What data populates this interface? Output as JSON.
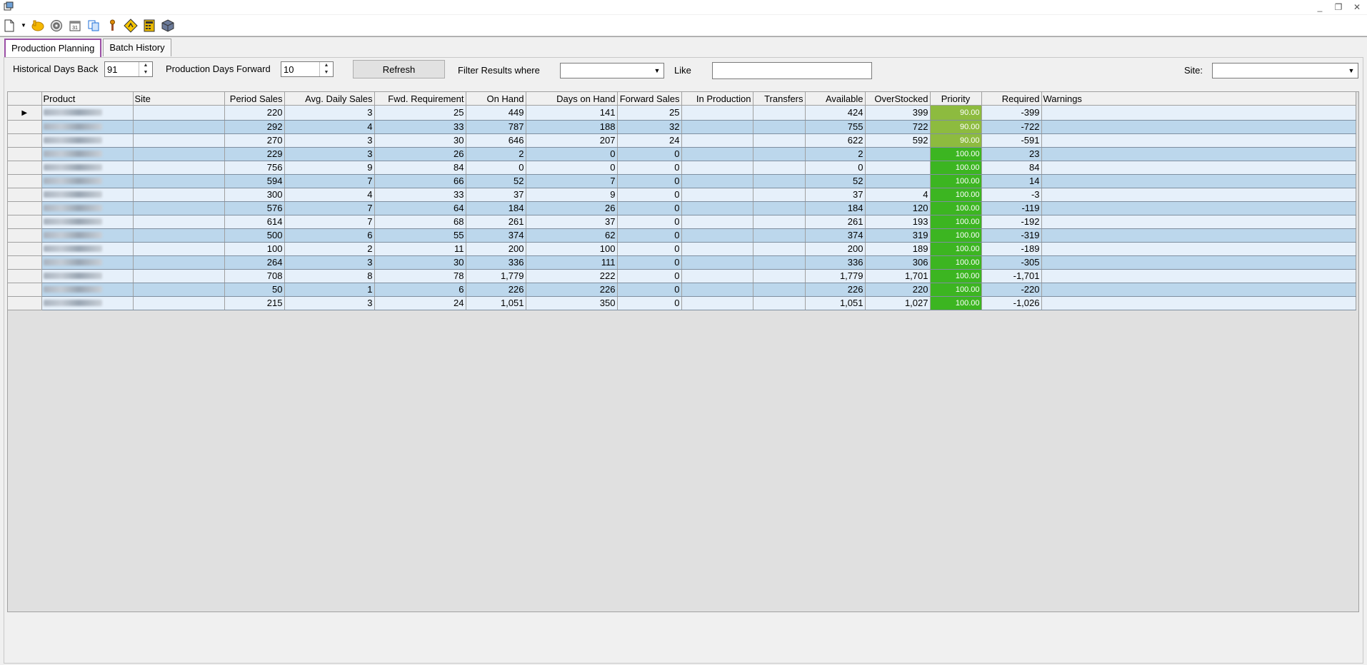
{
  "window": {
    "controls": [
      "_",
      "❐",
      "✕"
    ]
  },
  "toolbar": {
    "icons": [
      "new-document-icon",
      "dropdown-arrow-icon",
      "hand-icon",
      "disc-icon",
      "calendar-icon",
      "copy-icon",
      "tools-icon",
      "sign-icon",
      "calculator-icon",
      "cube-icon"
    ]
  },
  "tabs": [
    {
      "label": "Production Planning",
      "active": true
    },
    {
      "label": "Batch History",
      "active": false
    }
  ],
  "filters": {
    "historical_label": "Historical Days Back",
    "historical_value": "91",
    "forward_label": "Production Days Forward",
    "forward_value": "10",
    "refresh_label": "Refresh",
    "filter_label": "Filter Results where",
    "filter_value": "",
    "like_label": "Like",
    "like_value": "",
    "site_label": "Site:",
    "site_value": ""
  },
  "grid": {
    "columns": [
      "Product",
      "Site",
      "Period Sales",
      "Avg. Daily Sales",
      "Fwd. Requirement",
      "On Hand",
      "Days on Hand",
      "Forward Sales",
      "In Production",
      "Transfers",
      "Available",
      "OverStocked",
      "Priority",
      "Required",
      "Warnings"
    ],
    "rows": [
      {
        "period": "220",
        "avg": "3",
        "fwd": "25",
        "onhand": "449",
        "days": "141",
        "fsales": "25",
        "avail": "424",
        "over": "399",
        "prio": "90.00",
        "req": "-399"
      },
      {
        "period": "292",
        "avg": "4",
        "fwd": "33",
        "onhand": "787",
        "days": "188",
        "fsales": "32",
        "avail": "755",
        "over": "722",
        "prio": "90.00",
        "req": "-722"
      },
      {
        "period": "270",
        "avg": "3",
        "fwd": "30",
        "onhand": "646",
        "days": "207",
        "fsales": "24",
        "avail": "622",
        "over": "592",
        "prio": "90.00",
        "req": "-591"
      },
      {
        "period": "229",
        "avg": "3",
        "fwd": "26",
        "onhand": "2",
        "days": "0",
        "fsales": "0",
        "avail": "2",
        "over": "",
        "prio": "100.00",
        "req": "23"
      },
      {
        "period": "756",
        "avg": "9",
        "fwd": "84",
        "onhand": "0",
        "days": "0",
        "fsales": "0",
        "avail": "0",
        "over": "",
        "prio": "100.00",
        "req": "84"
      },
      {
        "period": "594",
        "avg": "7",
        "fwd": "66",
        "onhand": "52",
        "days": "7",
        "fsales": "0",
        "avail": "52",
        "over": "",
        "prio": "100.00",
        "req": "14"
      },
      {
        "period": "300",
        "avg": "4",
        "fwd": "33",
        "onhand": "37",
        "days": "9",
        "fsales": "0",
        "avail": "37",
        "over": "4",
        "prio": "100.00",
        "req": "-3"
      },
      {
        "period": "576",
        "avg": "7",
        "fwd": "64",
        "onhand": "184",
        "days": "26",
        "fsales": "0",
        "avail": "184",
        "over": "120",
        "prio": "100.00",
        "req": "-119"
      },
      {
        "period": "614",
        "avg": "7",
        "fwd": "68",
        "onhand": "261",
        "days": "37",
        "fsales": "0",
        "avail": "261",
        "over": "193",
        "prio": "100.00",
        "req": "-192"
      },
      {
        "period": "500",
        "avg": "6",
        "fwd": "55",
        "onhand": "374",
        "days": "62",
        "fsales": "0",
        "avail": "374",
        "over": "319",
        "prio": "100.00",
        "req": "-319"
      },
      {
        "period": "100",
        "avg": "2",
        "fwd": "11",
        "onhand": "200",
        "days": "100",
        "fsales": "0",
        "avail": "200",
        "over": "189",
        "prio": "100.00",
        "req": "-189"
      },
      {
        "period": "264",
        "avg": "3",
        "fwd": "30",
        "onhand": "336",
        "days": "111",
        "fsales": "0",
        "avail": "336",
        "over": "306",
        "prio": "100.00",
        "req": "-305"
      },
      {
        "period": "708",
        "avg": "8",
        "fwd": "78",
        "onhand": "1,779",
        "days": "222",
        "fsales": "0",
        "avail": "1,779",
        "over": "1,701",
        "prio": "100.00",
        "req": "-1,701"
      },
      {
        "period": "50",
        "avg": "1",
        "fwd": "6",
        "onhand": "226",
        "days": "226",
        "fsales": "0",
        "avail": "226",
        "over": "220",
        "prio": "100.00",
        "req": "-220"
      },
      {
        "period": "215",
        "avg": "3",
        "fwd": "24",
        "onhand": "1,051",
        "days": "350",
        "fsales": "0",
        "avail": "1,051",
        "over": "1,027",
        "prio": "100.00",
        "req": "-1,026"
      }
    ]
  },
  "colors": {
    "priority_90": "#8dbb3f",
    "priority_100": "#3cb521",
    "row_light": "#e6f0fa",
    "row_dark": "#bcd7ec",
    "active_tab_border": "#9b4fa6"
  }
}
